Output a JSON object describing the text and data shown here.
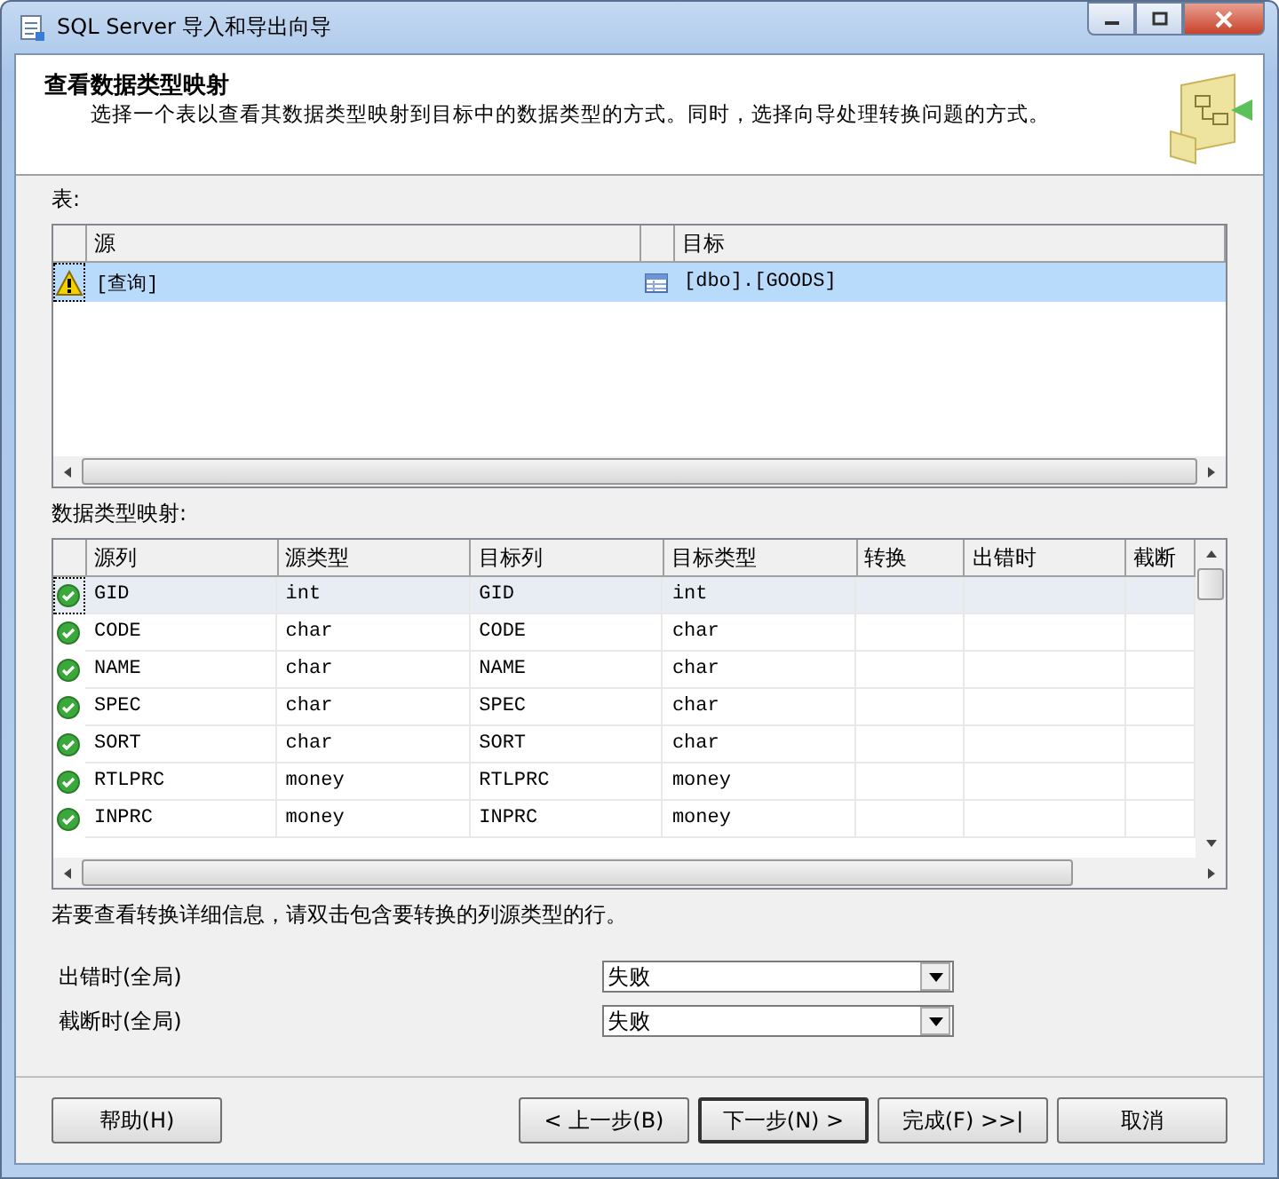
{
  "window": {
    "title": "SQL Server 导入和导出向导"
  },
  "header": {
    "title": "查看数据类型映射",
    "description": "选择一个表以查看其数据类型映射到目标中的数据类型的方式。同时，选择向导处理转换问题的方式。"
  },
  "tables_label": "表:",
  "tables": {
    "columns": [
      "源",
      "目标"
    ],
    "rows": [
      {
        "source": "[查询]",
        "target": "[dbo].[GOODS]",
        "kind": "warning",
        "selected": true
      }
    ]
  },
  "mapping_label": "数据类型映射:",
  "mapping": {
    "columns": [
      "源列",
      "源类型",
      "目标列",
      "目标类型",
      "转换",
      "出错时",
      "截断"
    ],
    "rows": [
      {
        "kind": "ok",
        "selected": true,
        "cells": [
          "GID",
          "int",
          "GID",
          "int"
        ]
      },
      {
        "kind": "ok",
        "selected": false,
        "cells": [
          "CODE",
          "char",
          "CODE",
          "char"
        ]
      },
      {
        "kind": "ok",
        "selected": false,
        "cells": [
          "NAME",
          "char",
          "NAME",
          "char"
        ]
      },
      {
        "kind": "ok",
        "selected": false,
        "cells": [
          "SPEC",
          "char",
          "SPEC",
          "char"
        ]
      },
      {
        "kind": "ok",
        "selected": false,
        "cells": [
          "SORT",
          "char",
          "SORT",
          "char"
        ]
      },
      {
        "kind": "ok",
        "selected": false,
        "cells": [
          "RTLPRC",
          "money",
          "RTLPRC",
          "money"
        ]
      },
      {
        "kind": "ok",
        "selected": false,
        "cells": [
          "INPRC",
          "money",
          "INPRC",
          "money"
        ]
      }
    ]
  },
  "note": "若要查看转换详细信息，请双击包含要转换的列源类型的行。",
  "options": [
    {
      "label": "出错时(全局)",
      "value": "失败"
    },
    {
      "label": "截断时(全局)",
      "value": "失败"
    }
  ],
  "buttons": [
    {
      "label": "帮助(H)",
      "kind": "help"
    },
    {
      "label": "< 上一步(B)",
      "kind": "nav"
    },
    {
      "label": "下一步(N) >",
      "kind": "default"
    },
    {
      "label": "完成(F) >>|",
      "kind": "nav"
    },
    {
      "label": "取消",
      "kind": "nav"
    }
  ]
}
